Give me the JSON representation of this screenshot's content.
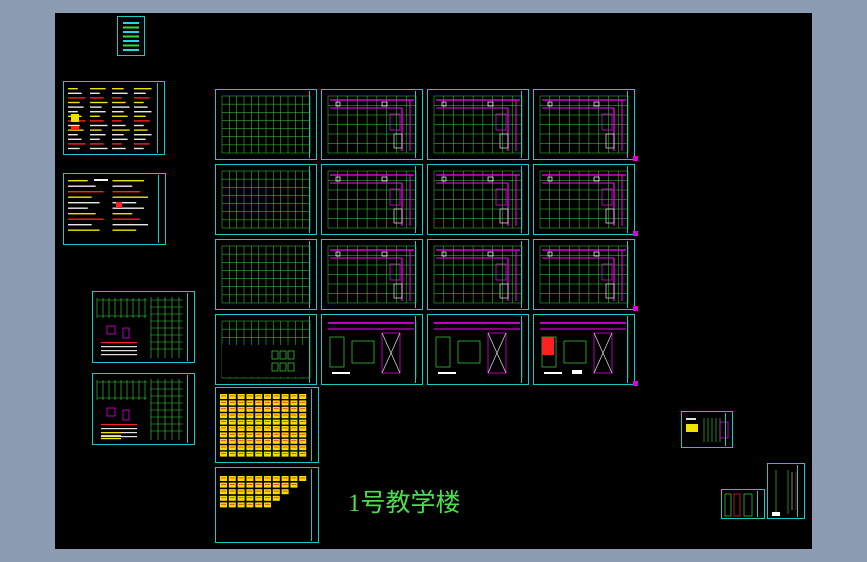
{
  "drawing": {
    "title": "1号教学楼"
  },
  "colors": {
    "workspace_frame": "#8b9bb1",
    "model_space": "#000000",
    "sheet_border": "#19c9c9",
    "grid_line": "#39d839",
    "wall_line": "#ff00ff",
    "text_yellow": "#f0e000",
    "text_red": "#ff2020",
    "title_green": "#49e04c"
  },
  "sheets": {
    "cover": {
      "kind": "cover"
    },
    "notes": [
      "text",
      "text"
    ],
    "details": [
      "detail",
      "detail"
    ],
    "plans": [
      "grid",
      "plan",
      "plan",
      "plan",
      "grid",
      "plan",
      "plan",
      "plan",
      "grid",
      "plan",
      "plan",
      "plan",
      "grid",
      "roof",
      "roof",
      "roof"
    ],
    "tables": [
      "table",
      "table"
    ],
    "extra": [
      "detail-small",
      "section-small",
      "section-tall"
    ]
  }
}
